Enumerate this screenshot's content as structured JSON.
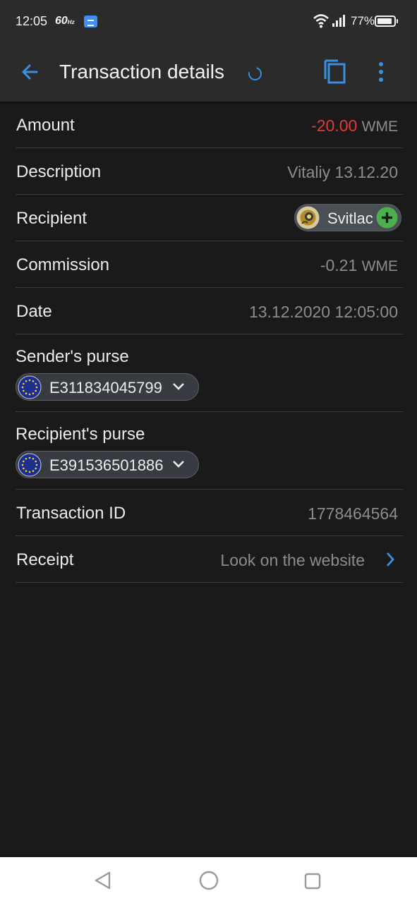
{
  "status_bar": {
    "time": "12:05",
    "refresh_rate": "60",
    "refresh_unit": "Hz",
    "battery_percent": "77%"
  },
  "toolbar": {
    "title": "Transaction details",
    "icons": [
      "back-arrow-icon",
      "loading-spinner-icon",
      "copy-icon",
      "more-vert-icon"
    ]
  },
  "details": {
    "amount": {
      "label": "Amount",
      "value": "-20.00",
      "unit": "WME"
    },
    "description": {
      "label": "Description",
      "value": "Vitaliy 13.12.20"
    },
    "recipient": {
      "label": "Recipient",
      "name": "Svitlac"
    },
    "commission": {
      "label": "Commission",
      "value": "-0.21",
      "unit": "WME"
    },
    "date": {
      "label": "Date",
      "value": "13.12.2020 12:05:00"
    },
    "sender_purse": {
      "label": "Sender's purse",
      "value": "E311834045799"
    },
    "recipient_purse": {
      "label": "Recipient's purse",
      "value": "E391536501886"
    },
    "transaction_id": {
      "label": "Transaction ID",
      "value": "1778464564"
    },
    "receipt": {
      "label": "Receipt",
      "link": "Look on the website"
    }
  },
  "colors": {
    "background": "#1a1a1a",
    "toolbar": "#2b2b2b",
    "accent": "#3b8fe0",
    "negative": "#e53935",
    "add_green": "#4caf50"
  }
}
